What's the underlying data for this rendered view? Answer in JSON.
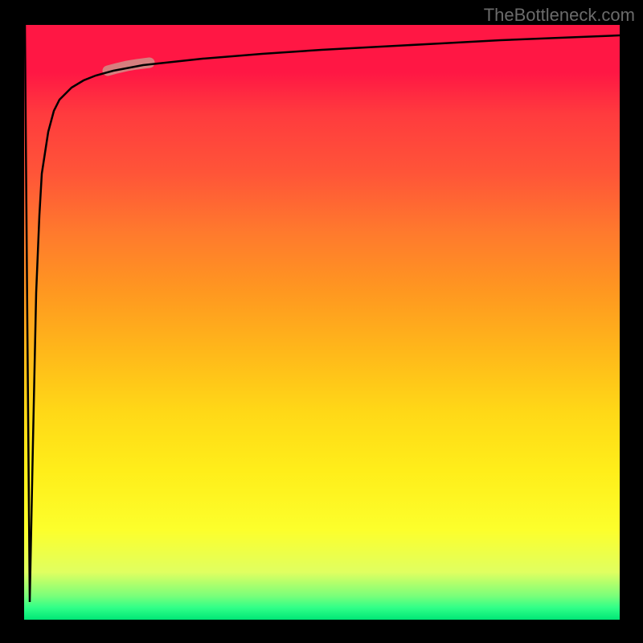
{
  "watermark": "TheBottleneck.com",
  "chart_data": {
    "type": "line",
    "title": "",
    "xlabel": "",
    "ylabel": "",
    "xlim": [
      0,
      100
    ],
    "ylim": [
      0,
      100
    ],
    "series": [
      {
        "name": "curve",
        "x": [
          0,
          0.5,
          1,
          1.5,
          2,
          2.5,
          3,
          4,
          5,
          6,
          8,
          10,
          12,
          15,
          20,
          25,
          30,
          40,
          50,
          60,
          70,
          80,
          90,
          100
        ],
        "values": [
          100,
          50,
          3,
          30,
          55,
          68,
          75,
          82,
          85.5,
          87.5,
          89.5,
          90.7,
          91.5,
          92.3,
          93.2,
          93.8,
          94.3,
          95.1,
          95.8,
          96.4,
          96.9,
          97.4,
          97.8,
          98.2
        ]
      }
    ],
    "highlight": {
      "x_start": 14,
      "x_end": 21,
      "description": "salmon-colored highlighted segment on curve"
    },
    "background_gradient": {
      "top": "#ff1744",
      "middle": "#ffd817",
      "bottom": "#00e676"
    }
  }
}
